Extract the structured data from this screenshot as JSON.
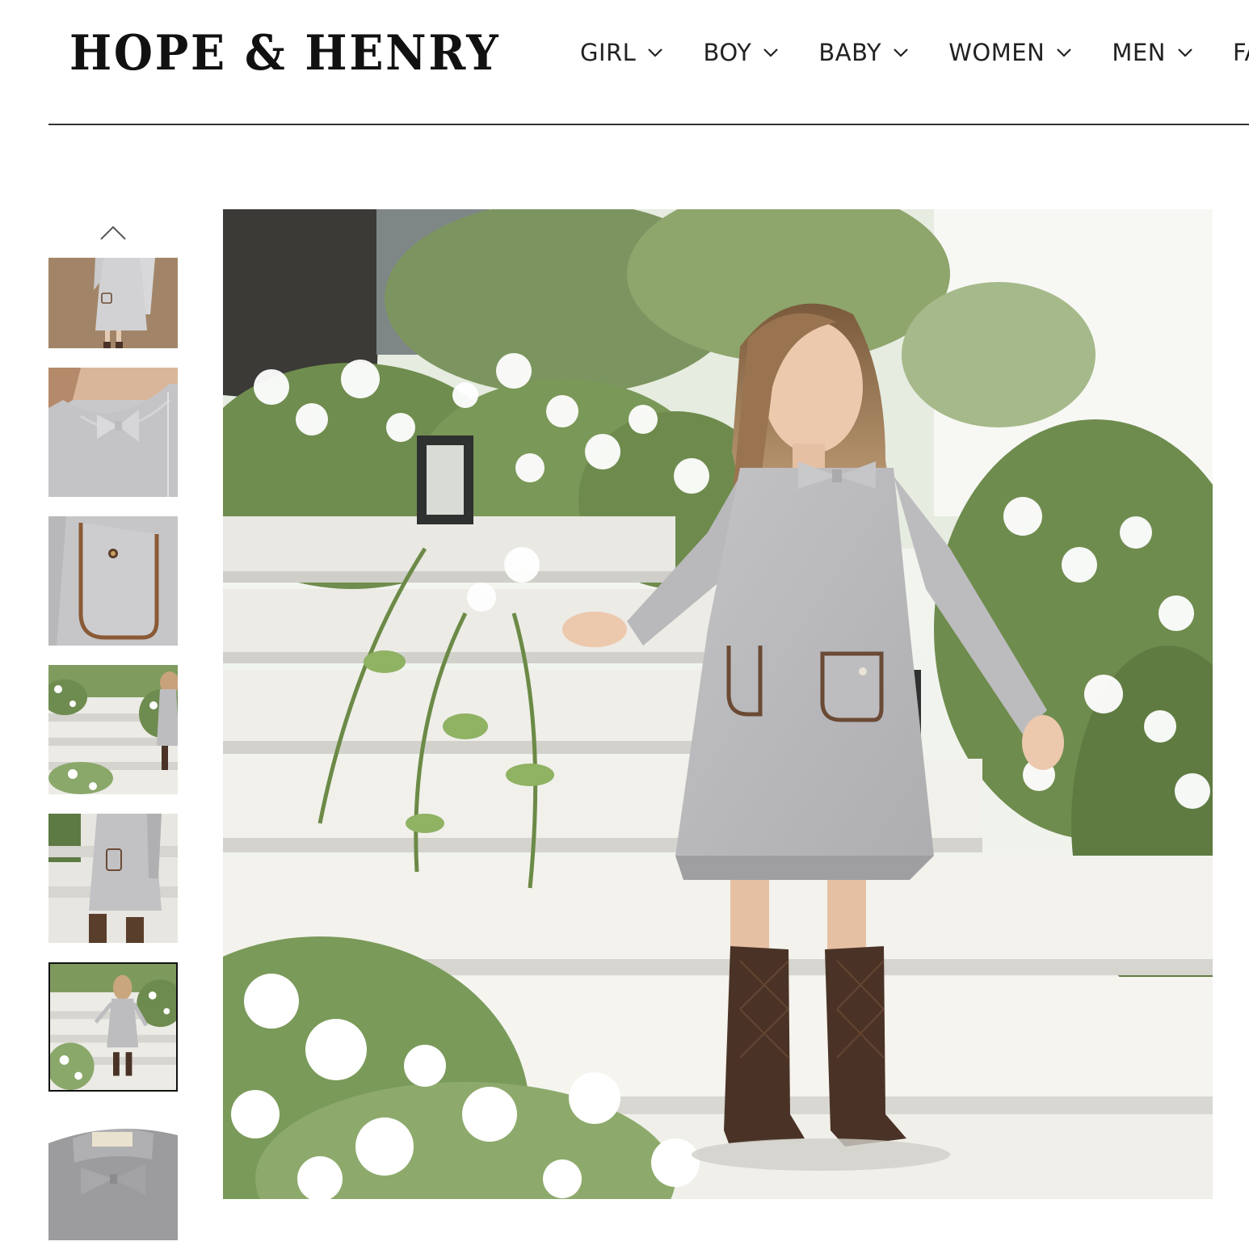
{
  "brand": {
    "logo_text": "HOPE & HENRY"
  },
  "nav": {
    "items": [
      {
        "label": "GIRL"
      },
      {
        "label": "BOY"
      },
      {
        "label": "BABY"
      },
      {
        "label": "WOMEN"
      },
      {
        "label": "MEN"
      },
      {
        "label": "FA"
      }
    ]
  },
  "gallery": {
    "active_index": 5,
    "thumbnails": [
      {
        "subject": "dress-full-front"
      },
      {
        "subject": "bow-collar-detail"
      },
      {
        "subject": "pocket-detail"
      },
      {
        "subject": "girl-on-steps"
      },
      {
        "subject": "dress-side-boots"
      },
      {
        "subject": "girl-on-steps-smiling"
      },
      {
        "subject": "label-and-bow-detail"
      }
    ],
    "main_image": {
      "subject": "girl-in-grey-dress-on-garden-steps"
    }
  },
  "colors": {
    "text": "#222222",
    "rule": "#333333",
    "dress_grey": "#b9b9bb",
    "trim_brown": "#6b4a35",
    "boot_brown": "#4a3326"
  }
}
